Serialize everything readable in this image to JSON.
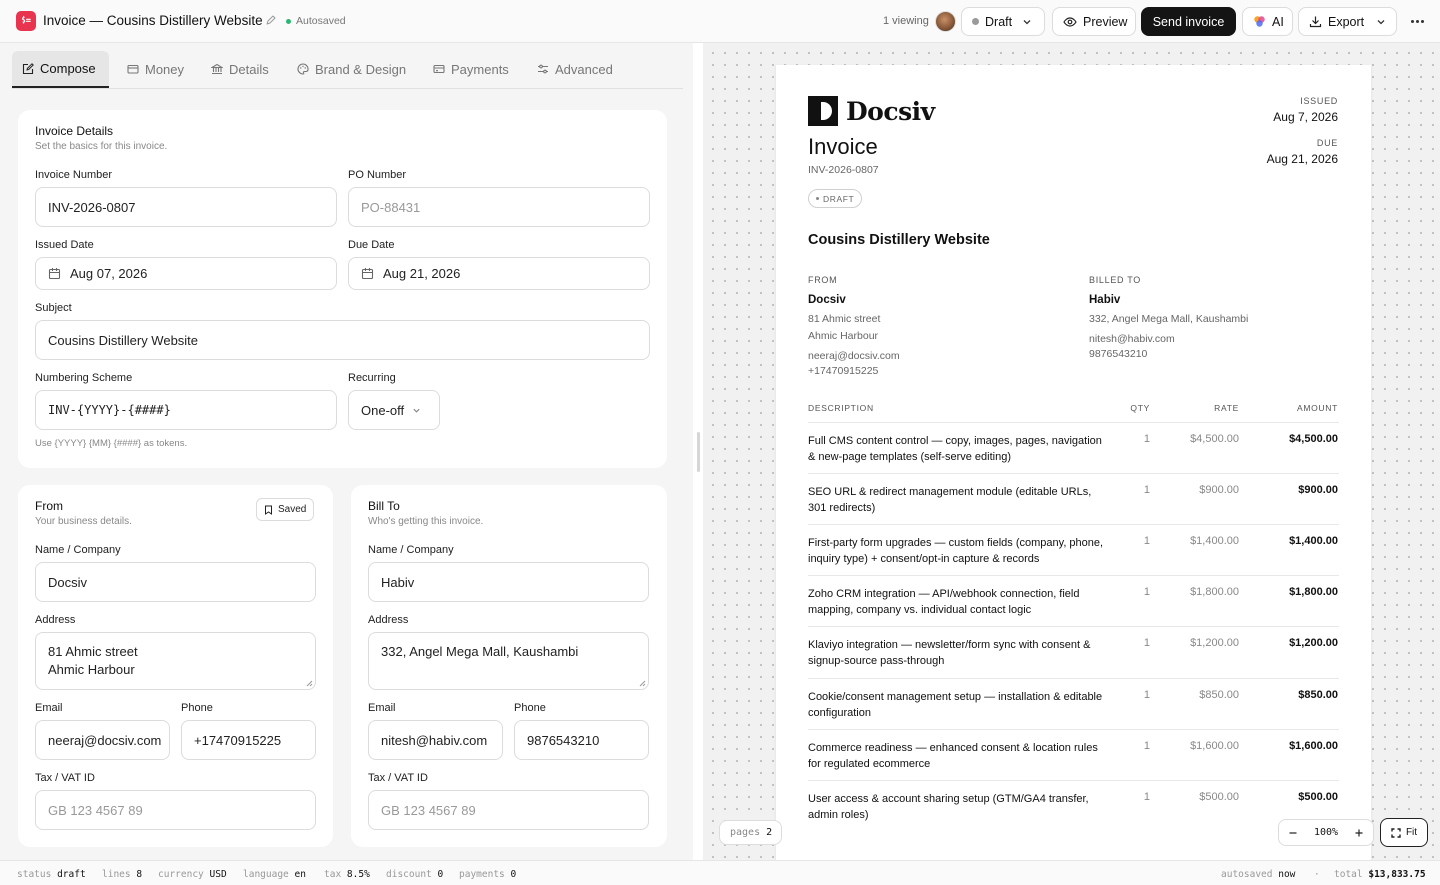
{
  "topbar": {
    "title": "Invoice — Cousins Distillery Website",
    "autosaved": "Autosaved",
    "viewing": "1 viewing",
    "status_label": "Draft",
    "preview_label": "Preview",
    "send_label": "Send invoice",
    "ai_label": "AI",
    "export_label": "Export"
  },
  "tabs": [
    "Compose",
    "Money",
    "Details",
    "Brand & Design",
    "Payments",
    "Advanced"
  ],
  "invoice_details": {
    "title": "Invoice Details",
    "subtitle": "Set the basics for this invoice.",
    "invoice_number_label": "Invoice Number",
    "invoice_number": "INV-2026-0807",
    "po_label": "PO Number",
    "po_placeholder": "PO-88431",
    "issued_label": "Issued Date",
    "issued_date": "Aug 07, 2026",
    "due_label": "Due Date",
    "due_date": "Aug 21, 2026",
    "subject_label": "Subject",
    "subject": "Cousins Distillery Website",
    "numbering_label": "Numbering Scheme",
    "numbering": "INV-{YYYY}-{####}",
    "recurring_label": "Recurring",
    "recurring": "One-off",
    "hint": "Use {YYYY} {MM} {####} as tokens."
  },
  "from": {
    "title": "From",
    "subtitle": "Your business details.",
    "saved_label": "Saved",
    "name_label": "Name / Company",
    "name": "Docsiv",
    "address_label": "Address",
    "address_line1": "81 Ahmic street",
    "address_line2": "Ahmic Harbour",
    "email_label": "Email",
    "email": "neeraj@docsiv.com",
    "phone_label": "Phone",
    "phone": "+17470915225",
    "tax_label": "Tax / VAT ID",
    "tax_placeholder": "GB 123 4567 89"
  },
  "bill_to": {
    "title": "Bill To",
    "subtitle": "Who's getting this invoice.",
    "name_label": "Name / Company",
    "name": "Habiv",
    "address_label": "Address",
    "address_line1": "332, Angel Mega Mall, Kaushambi",
    "email_label": "Email",
    "email": "nitesh@habiv.com",
    "phone_label": "Phone",
    "phone": "9876543210",
    "tax_label": "Tax / VAT ID",
    "tax_placeholder": "GB 123 4567 89"
  },
  "preview": {
    "brand": "Docsiv",
    "doc_title": "Invoice",
    "number": "INV-2026-0807",
    "badge": "DRAFT",
    "issued_label": "ISSUED",
    "issued": "Aug 7, 2026",
    "due_label": "DUE",
    "due": "Aug 21, 2026",
    "subject": "Cousins Distillery Website",
    "from_label": "FROM",
    "from_name": "Docsiv",
    "from_line1": "81 Ahmic street",
    "from_line2": "Ahmic Harbour",
    "from_email": "neeraj@docsiv.com",
    "from_phone": "+17470915225",
    "to_label": "BILLED TO",
    "to_name": "Habiv",
    "to_line1": "332, Angel Mega Mall, Kaushambi",
    "to_email": "nitesh@habiv.com",
    "to_phone": "9876543210",
    "col_description": "DESCRIPTION",
    "col_qty": "QTY",
    "col_rate": "RATE",
    "col_amount": "AMOUNT",
    "items": [
      {
        "description": "Full CMS content control — copy, images, pages, navigation & new-page templates (self-serve editing)",
        "qty": "1",
        "rate": "$4,500.00",
        "amount": "$4,500.00"
      },
      {
        "description": "SEO URL & redirect management module (editable URLs, 301 redirects)",
        "qty": "1",
        "rate": "$900.00",
        "amount": "$900.00"
      },
      {
        "description": "First-party form upgrades — custom fields (company, phone, inquiry type) + consent/opt-in capture & records",
        "qty": "1",
        "rate": "$1,400.00",
        "amount": "$1,400.00"
      },
      {
        "description": "Zoho CRM integration — API/webhook connection, field mapping, company vs. individual contact logic",
        "qty": "1",
        "rate": "$1,800.00",
        "amount": "$1,800.00"
      },
      {
        "description": "Klaviyo integration — newsletter/form sync with consent & signup-source pass-through",
        "qty": "1",
        "rate": "$1,200.00",
        "amount": "$1,200.00"
      },
      {
        "description": "Cookie/consent management setup — installation & editable configuration",
        "qty": "1",
        "rate": "$850.00",
        "amount": "$850.00"
      },
      {
        "description": "Commerce readiness — enhanced consent & location rules for regulated ecommerce",
        "qty": "1",
        "rate": "$1,600.00",
        "amount": "$1,600.00"
      },
      {
        "description": "User access & account sharing setup (GTM/GA4 transfer, admin roles)",
        "qty": "1",
        "rate": "$500.00",
        "amount": "$500.00"
      }
    ],
    "pages_label": "pages",
    "pages_value": "2",
    "zoom": "100%",
    "fit_label": "Fit"
  },
  "statusbar": {
    "status_k": "status",
    "status_v": "draft",
    "lines_k": "lines",
    "lines_v": "8",
    "currency_k": "currency",
    "currency_v": "USD",
    "language_k": "language",
    "language_v": "en",
    "tax_k": "tax",
    "tax_v": "8.5%",
    "discount_k": "discount",
    "discount_v": "0",
    "payments_k": "payments",
    "payments_v": "0",
    "autosaved_k": "autosaved",
    "autosaved_v": "now",
    "separator": "·",
    "total_k": "total",
    "total_v": "$13,833.75"
  }
}
